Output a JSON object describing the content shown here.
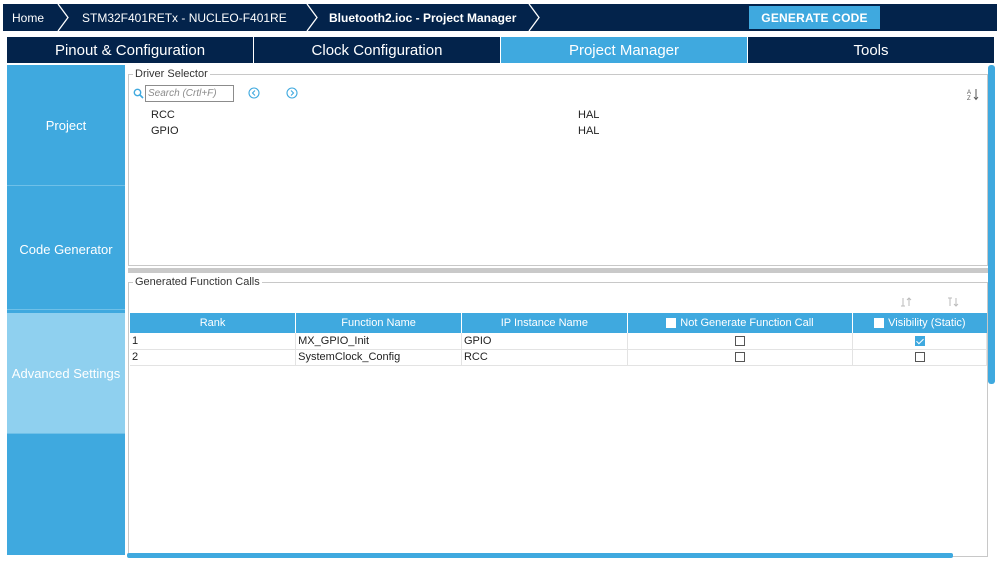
{
  "breadcrumb": {
    "home": "Home",
    "device": "STM32F401RETx  -  NUCLEO-F401RE",
    "file": "Bluetooth2.ioc - Project Manager"
  },
  "toolbar": {
    "generate_label": "GENERATE CODE"
  },
  "tabs": [
    {
      "label": "Pinout & Configuration"
    },
    {
      "label": "Clock Configuration"
    },
    {
      "label": "Project Manager"
    },
    {
      "label": "Tools"
    }
  ],
  "sidebar": {
    "items": [
      {
        "label": "Project"
      },
      {
        "label": "Code Generator"
      },
      {
        "label": "Advanced Settings"
      }
    ]
  },
  "driver_selector": {
    "title": "Driver Selector",
    "search_placeholder": "Search (Crtl+F)",
    "sort_icon": "sort-az-icon",
    "rows": [
      {
        "name": "RCC",
        "driver": "HAL"
      },
      {
        "name": "GPIO",
        "driver": "HAL"
      }
    ]
  },
  "function_calls": {
    "title": "Generated Function Calls",
    "columns": {
      "rank": "Rank",
      "function_name": "Function Name",
      "ip_instance": "IP Instance Name",
      "not_generate": "Not Generate Function Call",
      "visibility": "Visibility (Static)"
    },
    "rows": [
      {
        "rank": "1",
        "function": "MX_GPIO_Init",
        "ip": "GPIO",
        "not_generate": false,
        "visibility": true
      },
      {
        "rank": "2",
        "function": "SystemClock_Config",
        "ip": "RCC",
        "not_generate": false,
        "visibility": false
      }
    ]
  },
  "colors": {
    "dark_navy": "#03234b",
    "accent_blue": "#3fa9df",
    "nav_active": "#8fd0ef"
  }
}
